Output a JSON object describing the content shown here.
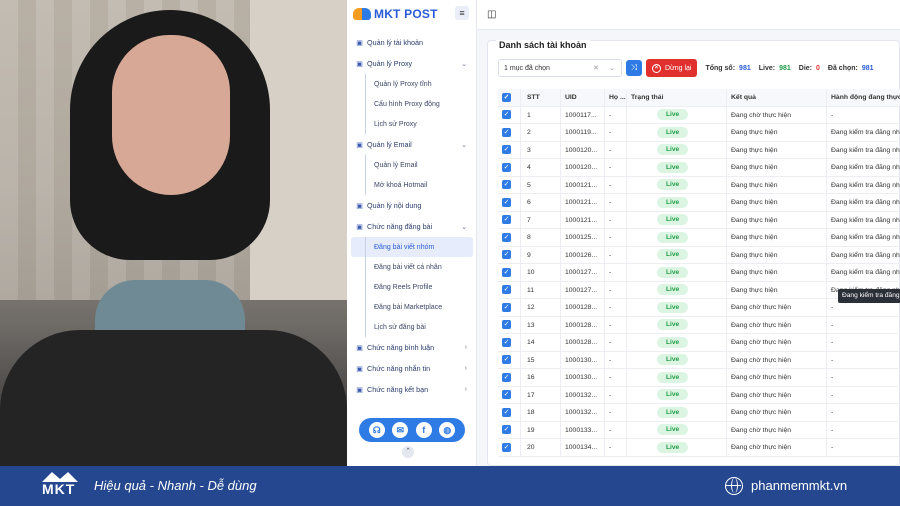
{
  "app": {
    "name": "MKT POST"
  },
  "sidebar": {
    "items": [
      {
        "icon": "grid-icon",
        "label": "Quản lý tài khoản",
        "chevron": "",
        "type": "main"
      },
      {
        "icon": "cube-icon",
        "label": "Quản lý Proxy",
        "chevron": "⌄",
        "type": "main"
      },
      {
        "label": "Quản lý Proxy tĩnh",
        "type": "sub"
      },
      {
        "label": "Cấu hình Proxy động",
        "type": "sub"
      },
      {
        "label": "Lịch sử Proxy",
        "type": "sub"
      },
      {
        "icon": "mail-icon",
        "label": "Quản lý Email",
        "chevron": "⌄",
        "type": "main"
      },
      {
        "label": "Quản lý Email",
        "type": "sub"
      },
      {
        "label": "Mở khoá Hotmail",
        "type": "sub"
      },
      {
        "icon": "content-icon",
        "label": "Quản lý nội dung",
        "chevron": "",
        "type": "main"
      },
      {
        "icon": "post-icon",
        "label": "Chức năng đăng bài",
        "chevron": "⌄",
        "type": "main"
      },
      {
        "label": "Đăng bài viết nhóm",
        "type": "sub",
        "active": true
      },
      {
        "label": "Đăng bài viết cá nhân",
        "type": "sub"
      },
      {
        "label": "Đăng Reels Profile",
        "type": "sub"
      },
      {
        "label": "Đăng bài Marketplace",
        "type": "sub"
      },
      {
        "label": "Lịch sử đăng bài",
        "type": "sub"
      },
      {
        "icon": "comment-icon",
        "label": "Chức năng bình luận",
        "chevron": "›",
        "type": "main"
      },
      {
        "icon": "message-icon",
        "label": "Chức năng nhắn tin",
        "chevron": "›",
        "type": "main"
      },
      {
        "icon": "friend-icon",
        "label": "Chức năng kết bạn",
        "chevron": "›",
        "type": "main"
      }
    ]
  },
  "panel": {
    "title": "Danh sách tài khoản",
    "select_value": "1 mục đã chọn",
    "stop_label": "Dừng lại",
    "stats": {
      "total_label": "Tổng số:",
      "total": "981",
      "live_label": "Live:",
      "live": "981",
      "die_label": "Die:",
      "die": "0",
      "selected_label": "Đã chọn:",
      "selected": "981"
    },
    "columns": [
      "STT",
      "UID",
      "Họ ...",
      "Trạng thái",
      "Kết quả",
      "Hành động đang thực"
    ],
    "rows": [
      {
        "stt": "1",
        "uid": "1000117...",
        "ho": "-",
        "status": "Live",
        "result": "Đang chờ thực hiện",
        "action": "-"
      },
      {
        "stt": "2",
        "uid": "1000119...",
        "ho": "-",
        "status": "Live",
        "result": "Đang thực hiện",
        "action": "Đang kiểm tra đăng nh"
      },
      {
        "stt": "3",
        "uid": "1000120...",
        "ho": "-",
        "status": "Live",
        "result": "Đang thực hiện",
        "action": "Đang kiểm tra đăng nh"
      },
      {
        "stt": "4",
        "uid": "1000120...",
        "ho": "-",
        "status": "Live",
        "result": "Đang thực hiện",
        "action": "Đang kiểm tra đăng nh"
      },
      {
        "stt": "5",
        "uid": "1000121...",
        "ho": "-",
        "status": "Live",
        "result": "Đang thực hiện",
        "action": "Đang kiểm tra đăng nh"
      },
      {
        "stt": "6",
        "uid": "1000121...",
        "ho": "-",
        "status": "Live",
        "result": "Đang thực hiện",
        "action": "Đang kiểm tra đăng nh"
      },
      {
        "stt": "7",
        "uid": "1000121...",
        "ho": "-",
        "status": "Live",
        "result": "Đang thực hiện",
        "action": "Đang kiểm tra đăng nh"
      },
      {
        "stt": "8",
        "uid": "1000125...",
        "ho": "-",
        "status": "Live",
        "result": "Đang thực hiện",
        "action": "Đang kiểm tra đăng nh"
      },
      {
        "stt": "9",
        "uid": "1000126...",
        "ho": "-",
        "status": "Live",
        "result": "Đang thực hiện",
        "action": "Đang kiểm tra đăng nh"
      },
      {
        "stt": "10",
        "uid": "1000127...",
        "ho": "-",
        "status": "Live",
        "result": "Đang thực hiện",
        "action": "Đang kiểm tra đăng nh"
      },
      {
        "stt": "11",
        "uid": "1000127...",
        "ho": "-",
        "status": "Live",
        "result": "Đang thực hiện",
        "action": "Đang kiểm tra đăng nh"
      },
      {
        "stt": "12",
        "uid": "1000128...",
        "ho": "-",
        "status": "Live",
        "result": "Đang chờ thực hiện",
        "action": "-"
      },
      {
        "stt": "13",
        "uid": "1000128...",
        "ho": "-",
        "status": "Live",
        "result": "Đang chờ thực hiện",
        "action": "-"
      },
      {
        "stt": "14",
        "uid": "1000128...",
        "ho": "-",
        "status": "Live",
        "result": "Đang chờ thực hiện",
        "action": "-"
      },
      {
        "stt": "15",
        "uid": "1000130...",
        "ho": "-",
        "status": "Live",
        "result": "Đang chờ thực hiện",
        "action": "-"
      },
      {
        "stt": "16",
        "uid": "1000130...",
        "ho": "-",
        "status": "Live",
        "result": "Đang chờ thực hiện",
        "action": "-"
      },
      {
        "stt": "17",
        "uid": "1000132...",
        "ho": "-",
        "status": "Live",
        "result": "Đang chờ thực hiện",
        "action": "-"
      },
      {
        "stt": "18",
        "uid": "1000132...",
        "ho": "-",
        "status": "Live",
        "result": "Đang chờ thực hiện",
        "action": "-"
      },
      {
        "stt": "19",
        "uid": "1000133...",
        "ho": "-",
        "status": "Live",
        "result": "Đang chờ thực hiện",
        "action": "-"
      },
      {
        "stt": "20",
        "uid": "1000134...",
        "ho": "-",
        "status": "Live",
        "result": "Đang chờ thực hiện",
        "action": "-"
      }
    ],
    "tooltip": "Đang kiểm tra đăng nh"
  },
  "footer": {
    "logo_text": "MKT",
    "slogan": "Hiệu quả - Nhanh - Dễ dùng",
    "website": "phanmemmkt.vn"
  },
  "colors": {
    "brand_blue": "#2f7be5",
    "stop_red": "#e0312f",
    "live_green": "#1f9c46",
    "footer_bg": "#24478f"
  }
}
